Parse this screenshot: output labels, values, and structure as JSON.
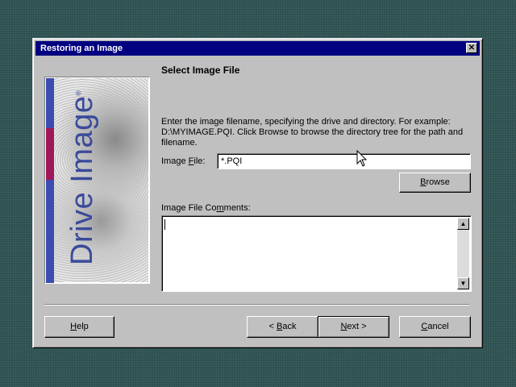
{
  "window": {
    "title": "Restoring an Image",
    "close_glyph": "✕"
  },
  "bitmap": {
    "brand_text": "Drive Image",
    "registered_mark": "®",
    "stripe_colors": [
      "#3c4cb0",
      "#a0185a",
      "#3c4cb0"
    ]
  },
  "page": {
    "heading": "Select Image File",
    "instructions": "Enter the image filename, specifying the drive and directory.  For example: D:\\MYIMAGE.PQI.  Click Browse to browse the directory tree for the path and filename."
  },
  "image_file": {
    "label": "Image File:",
    "value": "*.PQI"
  },
  "browse_button": {
    "label": "Browse"
  },
  "comments": {
    "label": "Image File Comments:",
    "value": ""
  },
  "buttons": {
    "help": "Help",
    "back": "< Back",
    "next": "Next >",
    "cancel": "Cancel"
  }
}
